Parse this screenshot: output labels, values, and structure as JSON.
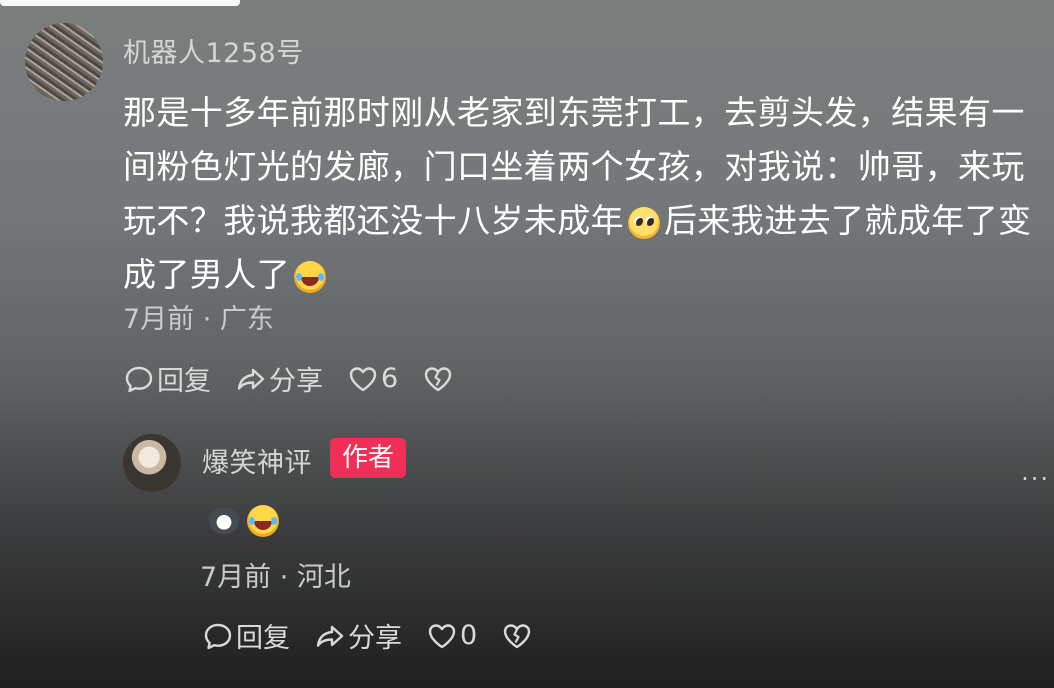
{
  "comment": {
    "username": "机器人1258号",
    "text_lines": [
      "那是十多年前那时刚从老家到东莞打工，去剪头发，结果有一",
      "间粉色灯光的发廊，门口坐着两个女孩，对我说：帅哥，来玩",
      "玩不？我说我都还没十八岁未成年",
      "后来我进去了就成年了变",
      "成了男人了"
    ],
    "emojis": [
      "pleading-face-emoji",
      "rolling-laughing-emoji"
    ],
    "meta": "7月前 · 广东",
    "actions": {
      "reply_label": "回复",
      "share_label": "分享",
      "like_count": "6"
    }
  },
  "reply": {
    "username": "爆笑神评",
    "badge": "作者",
    "emojis": [
      "cat-emoji",
      "rolling-laughing-emoji"
    ],
    "meta": "7月前 · 河北",
    "actions": {
      "reply_label": "回复",
      "share_label": "分享",
      "like_count": "0"
    },
    "more": "..."
  },
  "colors": {
    "author_badge": "#ef2f55",
    "text_primary": "#ffffff",
    "text_secondary": "#c9cbcb"
  }
}
